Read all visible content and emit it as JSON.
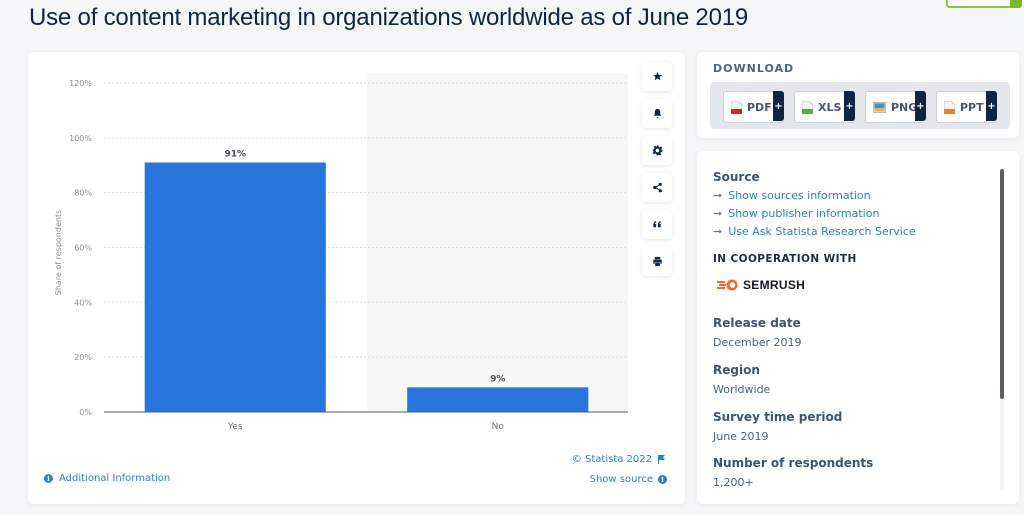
{
  "page": {
    "title": "Use of content marketing in organizations worldwide as of June 2019"
  },
  "chart_data": {
    "type": "bar",
    "title": "Use of content marketing in organizations worldwide as of June 2019",
    "categories": [
      "Yes",
      "No"
    ],
    "values": [
      91,
      9
    ],
    "data_labels": [
      "91%",
      "9%"
    ],
    "xlabel": "",
    "ylabel": "Share of respondents",
    "ylim": [
      0,
      120
    ],
    "yticks": [
      0,
      20,
      40,
      60,
      80,
      100,
      120
    ],
    "ytick_labels": [
      "0%",
      "20%",
      "40%",
      "60%",
      "80%",
      "100%",
      "120%"
    ],
    "grid": true,
    "bar_color": "#2876dd"
  },
  "chart_footer": {
    "copyright": "© Statista 2022",
    "show_source": "Show source",
    "additional_info": "Additional Information"
  },
  "toolbar": {
    "items": [
      {
        "name": "favorite",
        "icon": "star-icon"
      },
      {
        "name": "notification",
        "icon": "bell-icon"
      },
      {
        "name": "settings",
        "icon": "gear-icon"
      },
      {
        "name": "share",
        "icon": "share-icon"
      },
      {
        "name": "cite",
        "icon": "quote-icon"
      },
      {
        "name": "print",
        "icon": "printer-icon"
      }
    ]
  },
  "download": {
    "title": "DOWNLOAD",
    "buttons": [
      {
        "label": "PDF",
        "icon": "pdf-file-icon",
        "color": "#d9262c"
      },
      {
        "label": "XLS",
        "icon": "xls-file-icon",
        "color": "#5cab3a"
      },
      {
        "label": "PNG",
        "icon": "png-file-icon",
        "color": "#4a8ac9"
      },
      {
        "label": "PPT",
        "icon": "ppt-file-icon",
        "color": "#e9832a"
      }
    ],
    "plus": "+"
  },
  "info": {
    "source_heading": "Source",
    "links": [
      "Show sources information",
      "Show publisher information",
      "Use Ask Statista Research Service"
    ],
    "arrow": "➞",
    "coop_heading": "IN COOPERATION WITH",
    "partner": "SEMRUSH",
    "release_label": "Release date",
    "release_value": "December 2019",
    "region_label": "Region",
    "region_value": "Worldwide",
    "period_label": "Survey time period",
    "period_value": "June 2019",
    "respondents_label": "Number of respondents",
    "respondents_value": "1,200+"
  }
}
